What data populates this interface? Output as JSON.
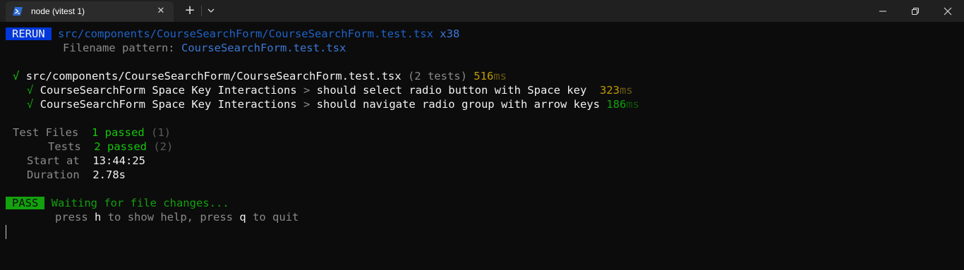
{
  "window": {
    "tab_title": "node (vitest 1)",
    "tab_icon": "powershell-icon",
    "close_tab_icon": "close-icon",
    "new_tab_icon": "plus-icon",
    "dropdown_icon": "chevron-down-icon",
    "minimize_icon": "minimize-icon",
    "maximize_icon": "restore-icon",
    "close_icon": "close-icon"
  },
  "terminal": {
    "rerun": {
      "badge": "RERUN",
      "path": "src/components/CourseSearchForm/CourseSearchForm.test.tsx",
      "count": "x38",
      "pattern_label": "Filename pattern:",
      "pattern_value": "CourseSearchForm.test.tsx"
    },
    "file_result": {
      "check": "√",
      "file": "src/components/CourseSearchForm/CourseSearchForm.test.tsx",
      "count": "(2 tests)",
      "duration_value": "516",
      "duration_unit": "ms"
    },
    "tests": [
      {
        "check": "√",
        "suite": "CourseSearchForm Space Key Interactions",
        "separator": ">",
        "name": "should select radio button with Space key",
        "duration_value": "323",
        "duration_unit": "ms"
      },
      {
        "check": "√",
        "suite": "CourseSearchForm Space Key Interactions",
        "separator": ">",
        "name": "should navigate radio group with arrow keys",
        "duration_value": "186",
        "duration_unit": "ms"
      }
    ],
    "summary": {
      "test_files_label": "Test Files",
      "test_files_value": "1 passed",
      "test_files_total": "(1)",
      "tests_label": "Tests",
      "tests_value": "2 passed",
      "tests_total": "(2)",
      "start_label": "Start at",
      "start_value": "13:44:25",
      "duration_label": "Duration",
      "duration_value": "2.78s"
    },
    "status": {
      "badge": "PASS",
      "message": "Waiting for file changes...",
      "help_press1": "press",
      "help_key1": "h",
      "help_text1": "to show help, press",
      "help_key2": "q",
      "help_text2": "to quit"
    }
  },
  "colors": {
    "background": "#0c0c0c",
    "titlebar": "#202020",
    "rerun_badge": "#0037da",
    "pass_badge": "#13a10e",
    "pass_green": "#16c60c",
    "duration_yellow": "#c19c00"
  }
}
